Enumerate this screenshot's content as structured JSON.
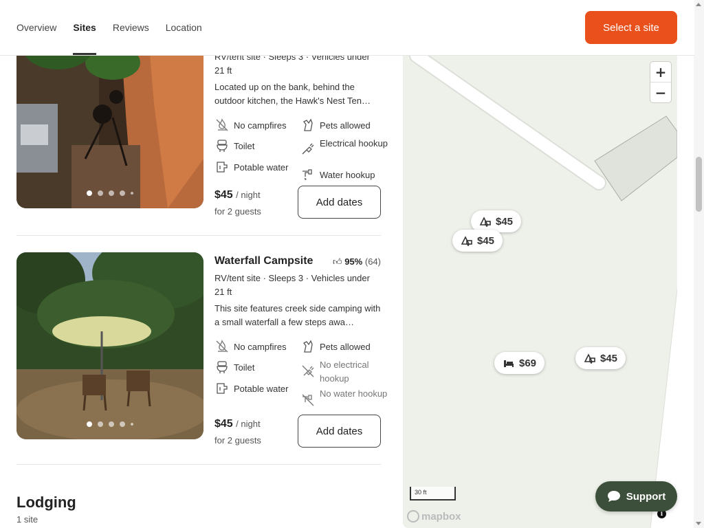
{
  "nav": {
    "tabs": [
      {
        "label": "Overview"
      },
      {
        "label": "Sites"
      },
      {
        "label": "Reviews"
      },
      {
        "label": "Location"
      }
    ],
    "active_tab": "Sites",
    "cta_label": "Select a site"
  },
  "sites": [
    {
      "meta": "RV/tent site · Sleeps 3 · Vehicles under 21 ft",
      "description": "Located up on the bank, behind the outdoor kitchen, the Hawk's Nest Ten…",
      "amenities_left": [
        "No campfires",
        "Toilet",
        "Potable water"
      ],
      "amenities_right": [
        "Pets allowed",
        "Electrical hookup",
        "Water hookup"
      ],
      "price": "$45",
      "price_unit": "/ night",
      "guests": "for 2 guests",
      "button": "Add dates"
    },
    {
      "name": "Waterfall Campsite",
      "rating_pct": "95%",
      "rating_count": "(64)",
      "meta": "RV/tent site · Sleeps 3 · Vehicles under 21 ft",
      "description": "This site features creek side camping with a small waterfall a few steps awa…",
      "amenities_left": [
        "No campfires",
        "Toilet",
        "Potable water"
      ],
      "amenities_right": [
        "Pets allowed",
        "No electrical hookup",
        "No water hookup"
      ],
      "price": "$45",
      "price_unit": "/ night",
      "guests": "for 2 guests",
      "button": "Add dates"
    }
  ],
  "lodging": {
    "title": "Lodging",
    "count": "1 site"
  },
  "map": {
    "pins": [
      {
        "label": "$45",
        "icon": "rv-tent-icon"
      },
      {
        "label": "$45",
        "icon": "rv-tent-icon"
      },
      {
        "label": "$69",
        "icon": "bed-icon"
      },
      {
        "label": "$45",
        "icon": "rv-tent-icon"
      }
    ],
    "scale_label": "30 ft",
    "attribution": "mapbox"
  },
  "support_label": "Support",
  "colors": {
    "accent": "#e9501b",
    "support_bg": "#3c4f3a"
  }
}
